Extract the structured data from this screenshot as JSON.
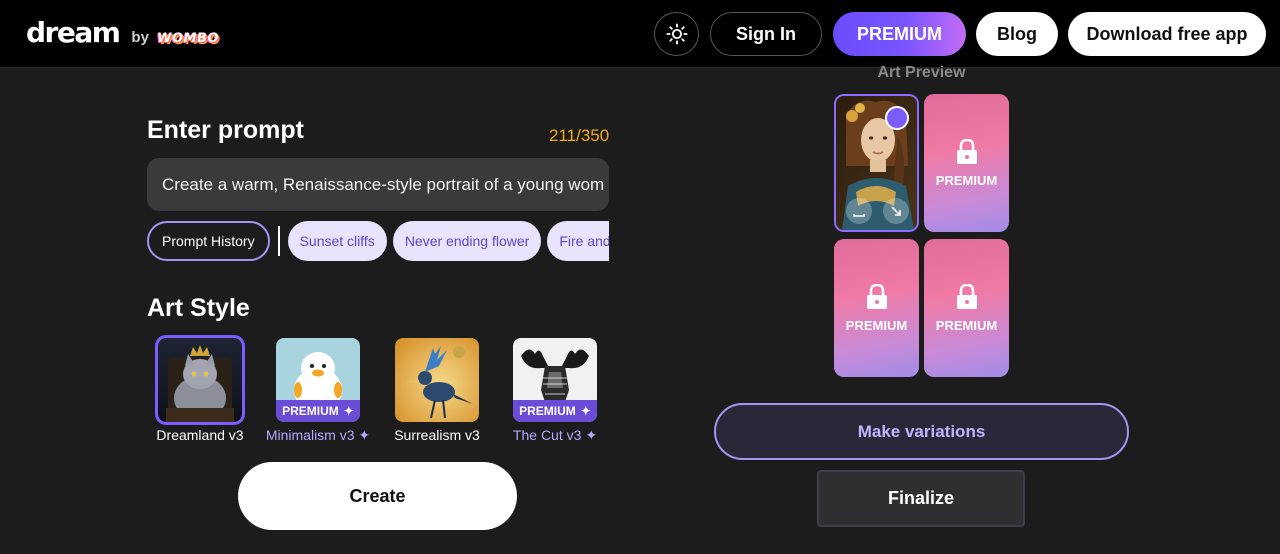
{
  "header": {
    "logo_dream": "dream",
    "logo_by": "by",
    "logo_wombo": "WOMBO",
    "theme_icon": "sun-icon",
    "sign_in": "Sign In",
    "premium": "PREMIUM",
    "blog": "Blog",
    "download": "Download free app"
  },
  "prompt": {
    "title": "Enter prompt",
    "count": "211/350",
    "value": "Create a warm, Renaissance-style portrait of a young wom"
  },
  "chips": {
    "history": "Prompt History",
    "items": [
      "Sunset cliffs",
      "Never ending flower",
      "Fire and water"
    ]
  },
  "art_style": {
    "title": "Art Style",
    "badge": "PREMIUM",
    "items": [
      {
        "label": "Dreamland v3",
        "premium": false,
        "selected": true
      },
      {
        "label": "Minimalism v3",
        "premium": true,
        "selected": false
      },
      {
        "label": "Surrealism v3",
        "premium": false,
        "selected": false
      },
      {
        "label": "The Cut v3",
        "premium": true,
        "selected": false
      }
    ],
    "sparkle": "✦"
  },
  "create_button": "Create",
  "preview": {
    "title": "Art Preview",
    "locked_label": "PREMIUM"
  },
  "make_variations": "Make variations",
  "finalize": "Finalize",
  "colors": {
    "accent": "#7b5cff",
    "count": "#f0a818",
    "chip_bg": "#e9e3fd",
    "premium_tile": "#f07aa5"
  }
}
